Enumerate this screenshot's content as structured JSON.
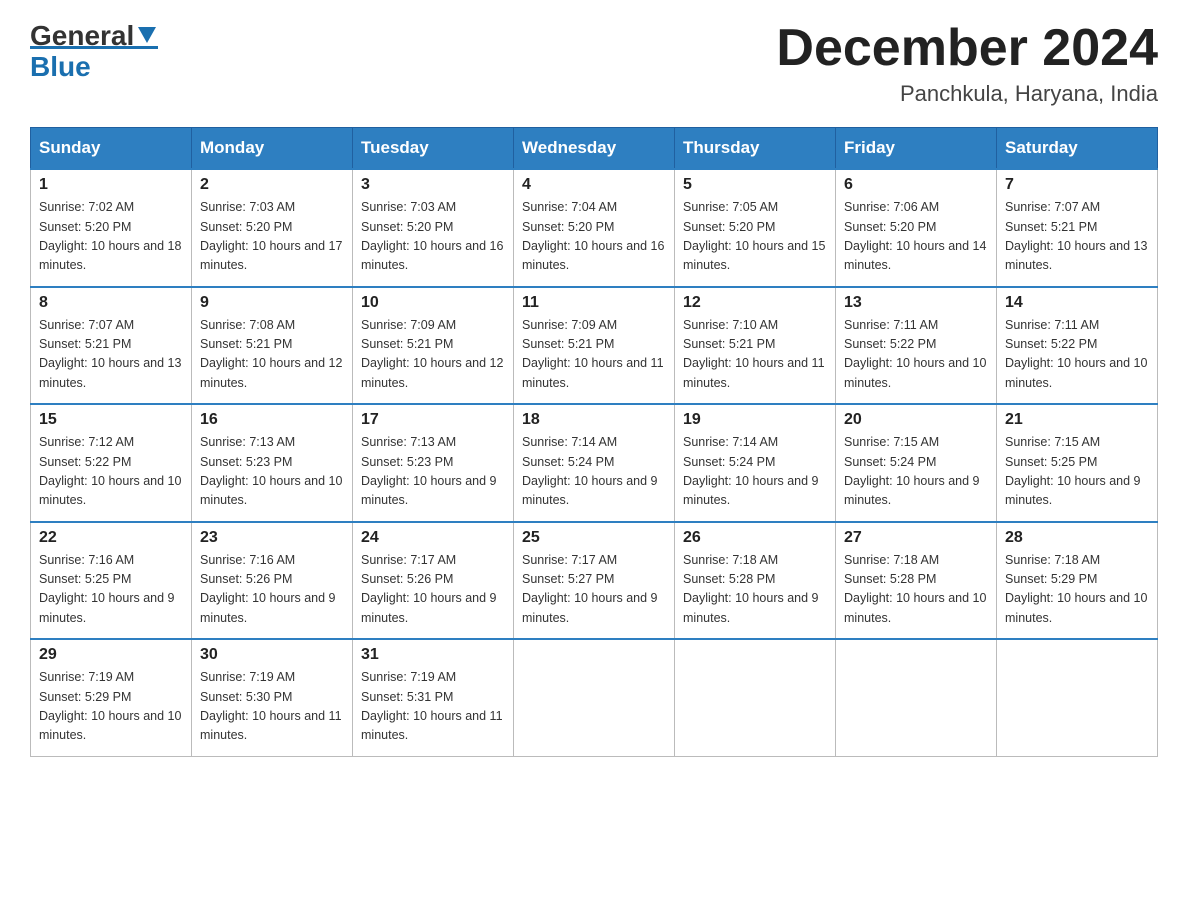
{
  "header": {
    "logo_general": "General",
    "logo_blue": "Blue",
    "month": "December 2024",
    "location": "Panchkula, Haryana, India"
  },
  "days_of_week": [
    "Sunday",
    "Monday",
    "Tuesday",
    "Wednesday",
    "Thursday",
    "Friday",
    "Saturday"
  ],
  "weeks": [
    [
      {
        "day": "1",
        "sunrise": "7:02 AM",
        "sunset": "5:20 PM",
        "daylight": "10 hours and 18 minutes."
      },
      {
        "day": "2",
        "sunrise": "7:03 AM",
        "sunset": "5:20 PM",
        "daylight": "10 hours and 17 minutes."
      },
      {
        "day": "3",
        "sunrise": "7:03 AM",
        "sunset": "5:20 PM",
        "daylight": "10 hours and 16 minutes."
      },
      {
        "day": "4",
        "sunrise": "7:04 AM",
        "sunset": "5:20 PM",
        "daylight": "10 hours and 16 minutes."
      },
      {
        "day": "5",
        "sunrise": "7:05 AM",
        "sunset": "5:20 PM",
        "daylight": "10 hours and 15 minutes."
      },
      {
        "day": "6",
        "sunrise": "7:06 AM",
        "sunset": "5:20 PM",
        "daylight": "10 hours and 14 minutes."
      },
      {
        "day": "7",
        "sunrise": "7:07 AM",
        "sunset": "5:21 PM",
        "daylight": "10 hours and 13 minutes."
      }
    ],
    [
      {
        "day": "8",
        "sunrise": "7:07 AM",
        "sunset": "5:21 PM",
        "daylight": "10 hours and 13 minutes."
      },
      {
        "day": "9",
        "sunrise": "7:08 AM",
        "sunset": "5:21 PM",
        "daylight": "10 hours and 12 minutes."
      },
      {
        "day": "10",
        "sunrise": "7:09 AM",
        "sunset": "5:21 PM",
        "daylight": "10 hours and 12 minutes."
      },
      {
        "day": "11",
        "sunrise": "7:09 AM",
        "sunset": "5:21 PM",
        "daylight": "10 hours and 11 minutes."
      },
      {
        "day": "12",
        "sunrise": "7:10 AM",
        "sunset": "5:21 PM",
        "daylight": "10 hours and 11 minutes."
      },
      {
        "day": "13",
        "sunrise": "7:11 AM",
        "sunset": "5:22 PM",
        "daylight": "10 hours and 10 minutes."
      },
      {
        "day": "14",
        "sunrise": "7:11 AM",
        "sunset": "5:22 PM",
        "daylight": "10 hours and 10 minutes."
      }
    ],
    [
      {
        "day": "15",
        "sunrise": "7:12 AM",
        "sunset": "5:22 PM",
        "daylight": "10 hours and 10 minutes."
      },
      {
        "day": "16",
        "sunrise": "7:13 AM",
        "sunset": "5:23 PM",
        "daylight": "10 hours and 10 minutes."
      },
      {
        "day": "17",
        "sunrise": "7:13 AM",
        "sunset": "5:23 PM",
        "daylight": "10 hours and 9 minutes."
      },
      {
        "day": "18",
        "sunrise": "7:14 AM",
        "sunset": "5:24 PM",
        "daylight": "10 hours and 9 minutes."
      },
      {
        "day": "19",
        "sunrise": "7:14 AM",
        "sunset": "5:24 PM",
        "daylight": "10 hours and 9 minutes."
      },
      {
        "day": "20",
        "sunrise": "7:15 AM",
        "sunset": "5:24 PM",
        "daylight": "10 hours and 9 minutes."
      },
      {
        "day": "21",
        "sunrise": "7:15 AM",
        "sunset": "5:25 PM",
        "daylight": "10 hours and 9 minutes."
      }
    ],
    [
      {
        "day": "22",
        "sunrise": "7:16 AM",
        "sunset": "5:25 PM",
        "daylight": "10 hours and 9 minutes."
      },
      {
        "day": "23",
        "sunrise": "7:16 AM",
        "sunset": "5:26 PM",
        "daylight": "10 hours and 9 minutes."
      },
      {
        "day": "24",
        "sunrise": "7:17 AM",
        "sunset": "5:26 PM",
        "daylight": "10 hours and 9 minutes."
      },
      {
        "day": "25",
        "sunrise": "7:17 AM",
        "sunset": "5:27 PM",
        "daylight": "10 hours and 9 minutes."
      },
      {
        "day": "26",
        "sunrise": "7:18 AM",
        "sunset": "5:28 PM",
        "daylight": "10 hours and 9 minutes."
      },
      {
        "day": "27",
        "sunrise": "7:18 AM",
        "sunset": "5:28 PM",
        "daylight": "10 hours and 10 minutes."
      },
      {
        "day": "28",
        "sunrise": "7:18 AM",
        "sunset": "5:29 PM",
        "daylight": "10 hours and 10 minutes."
      }
    ],
    [
      {
        "day": "29",
        "sunrise": "7:19 AM",
        "sunset": "5:29 PM",
        "daylight": "10 hours and 10 minutes."
      },
      {
        "day": "30",
        "sunrise": "7:19 AM",
        "sunset": "5:30 PM",
        "daylight": "10 hours and 11 minutes."
      },
      {
        "day": "31",
        "sunrise": "7:19 AM",
        "sunset": "5:31 PM",
        "daylight": "10 hours and 11 minutes."
      },
      null,
      null,
      null,
      null
    ]
  ]
}
